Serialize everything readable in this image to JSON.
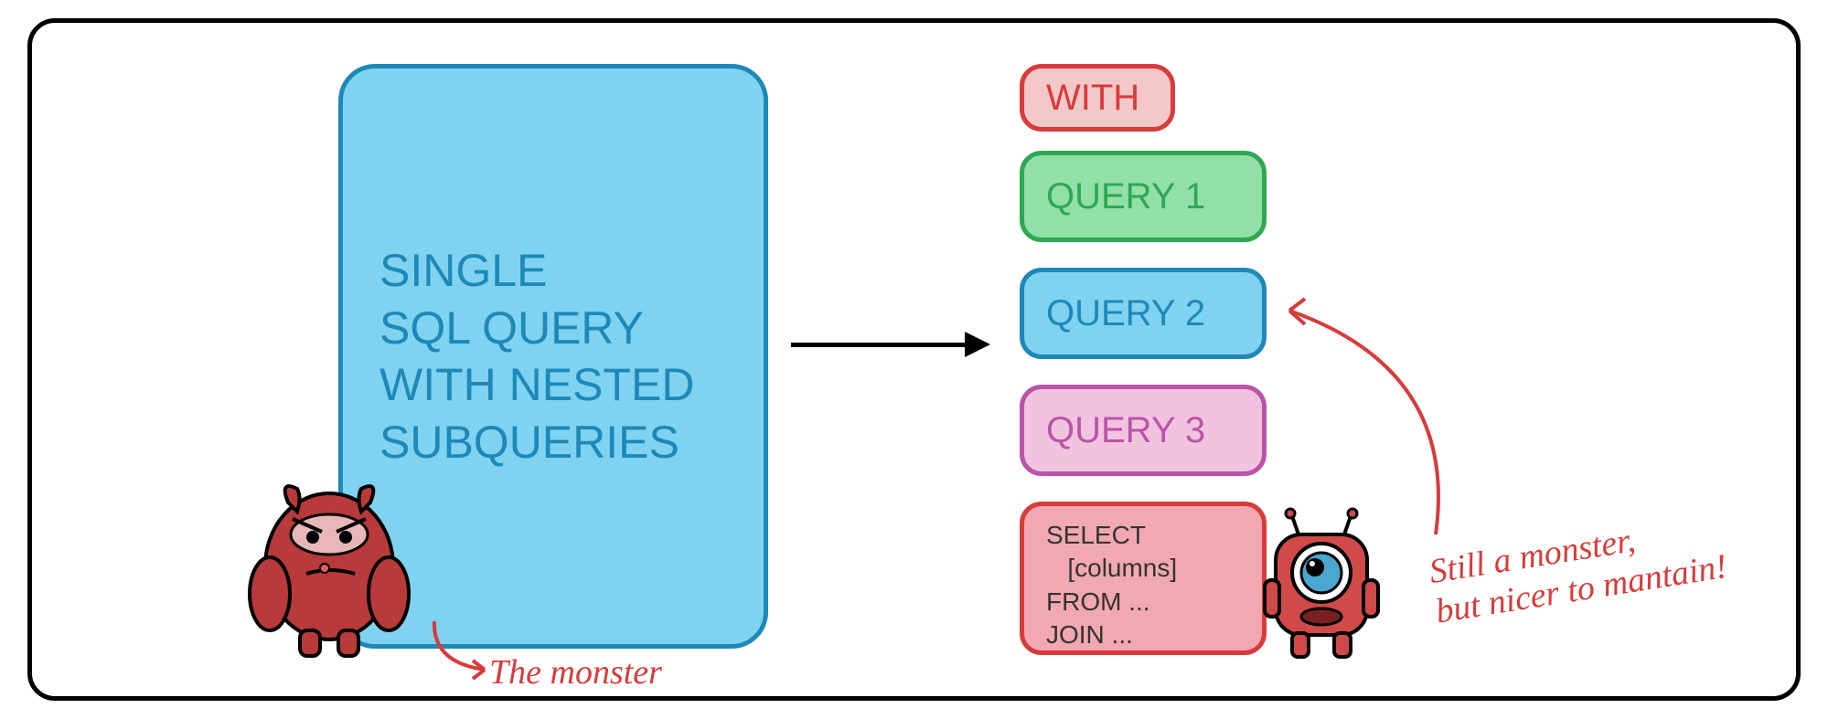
{
  "left_box": {
    "text": "SINGLE\nSQL QUERY\nWITH NESTED\nSUBQUERIES"
  },
  "right_boxes": {
    "with": "WITH",
    "q1": "QUERY 1",
    "q2": "QUERY 2",
    "q3": "QUERY 3",
    "select": "SELECT\n   [columns]\nFROM ...\nJOIN ..."
  },
  "annotations": {
    "left": "The monster",
    "right": "Still a monster,\nbut nicer to mantain!"
  }
}
